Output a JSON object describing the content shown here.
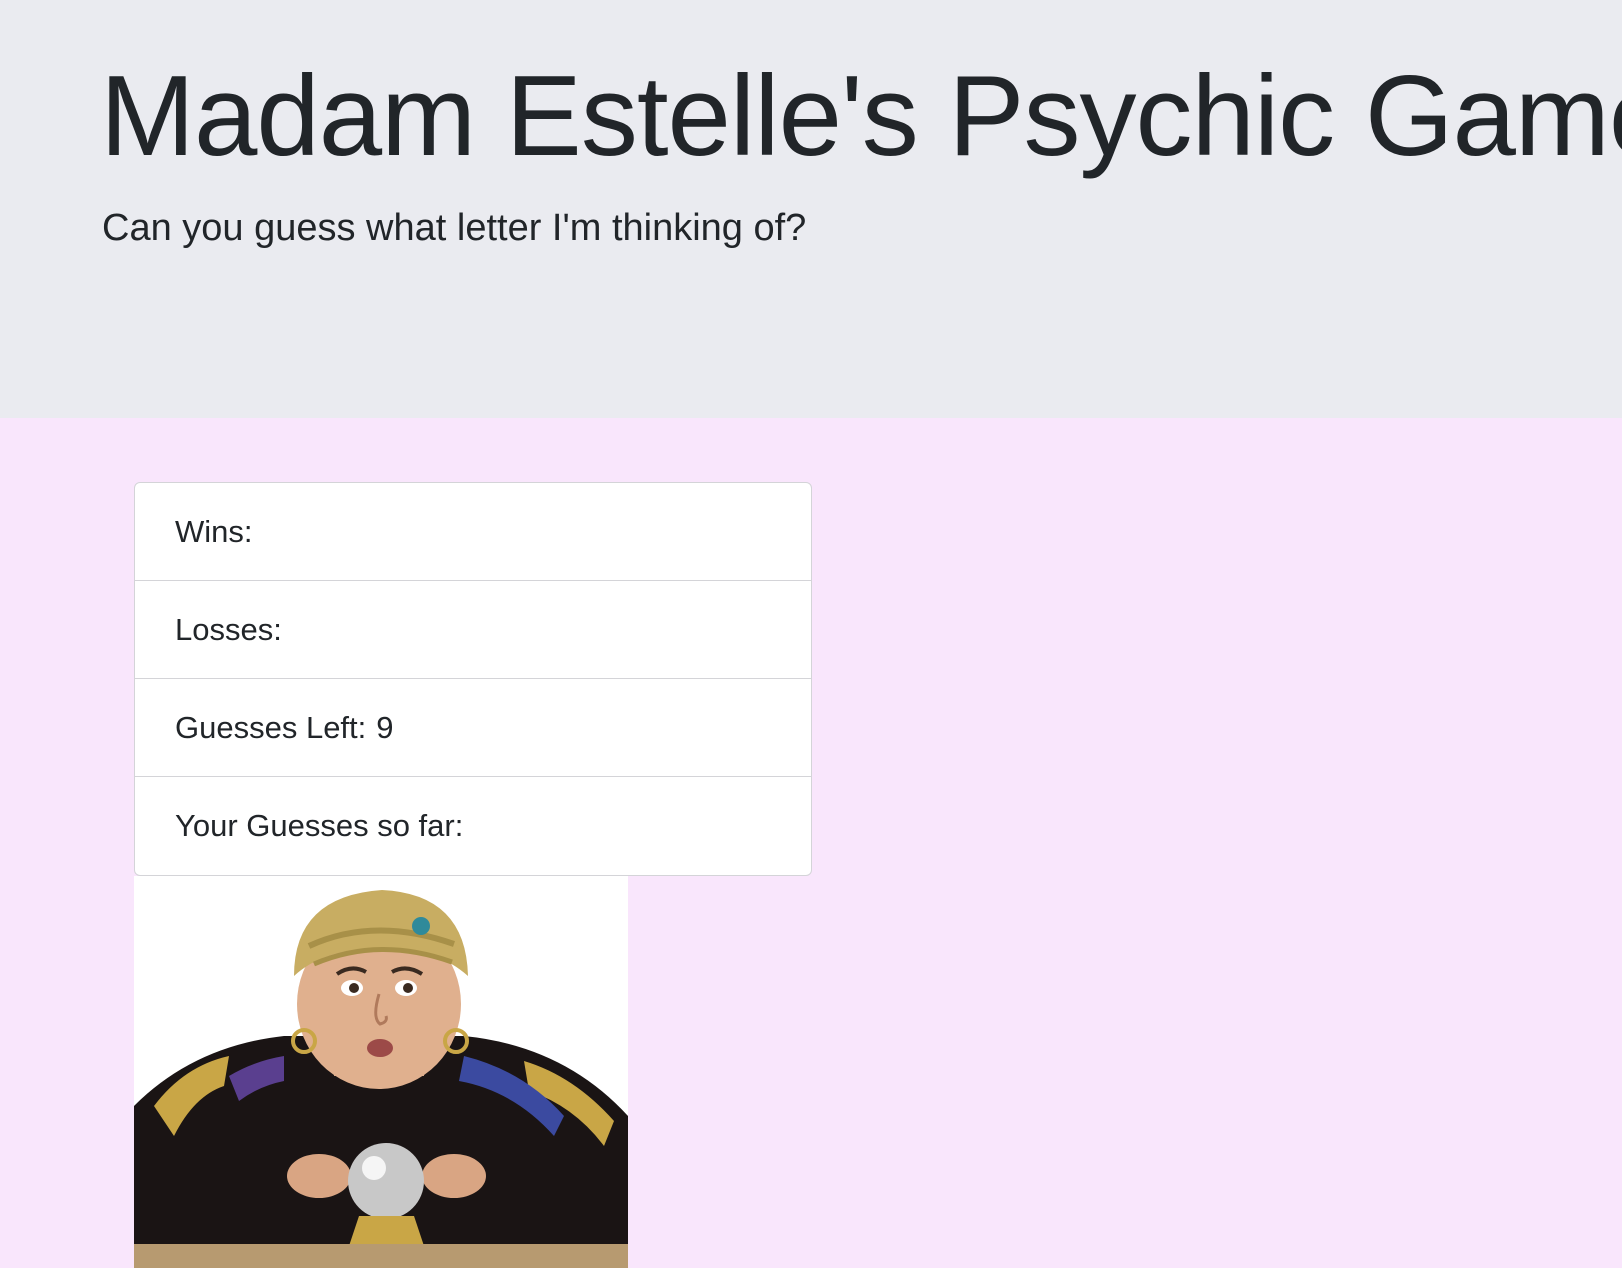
{
  "header": {
    "title": "Madam Estelle's Psychic Game",
    "subtitle": "Can you guess what letter I'm thinking of?"
  },
  "stats": {
    "wins_label": "Wins:",
    "wins_value": "",
    "losses_label": "Losses:",
    "losses_value": "",
    "guesses_left_label": "Guesses Left:",
    "guesses_left_value": "9",
    "guesses_so_far_label": "Your Guesses so far:",
    "guesses_so_far_value": ""
  },
  "image": {
    "alt": "fortune teller with crystal ball"
  },
  "colors": {
    "header_bg": "#eaebf0",
    "page_bg": "#f9e6fc",
    "text": "#212529",
    "card_border": "#d4d4d8"
  }
}
